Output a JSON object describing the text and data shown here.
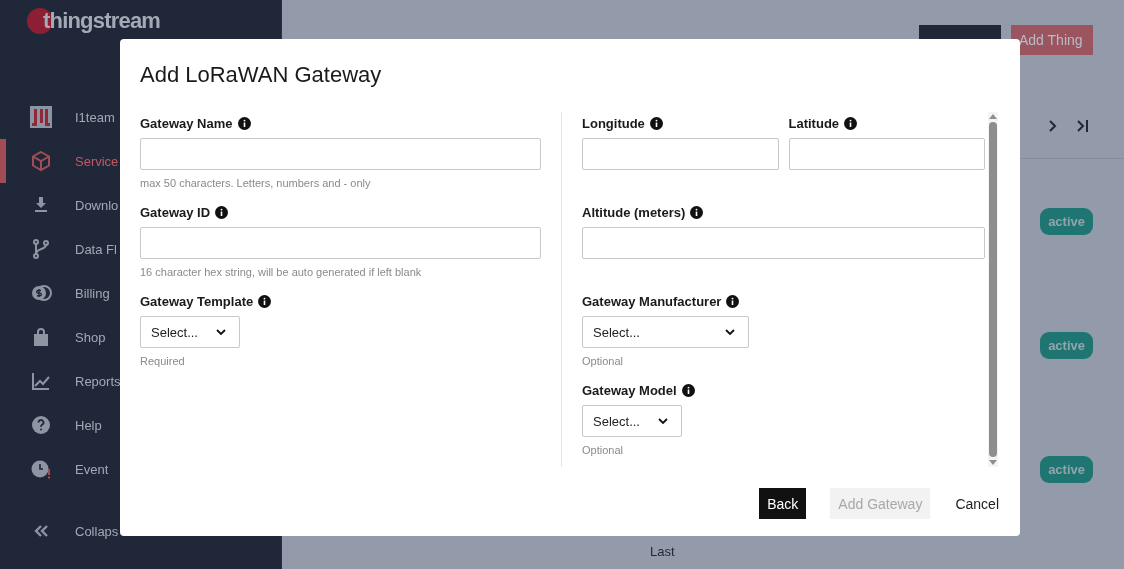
{
  "sidebar": {
    "logo": "thingstream",
    "team": {
      "label": "I1team"
    },
    "items": [
      {
        "label": "Service",
        "selected": true
      },
      {
        "label": "Downlo",
        "selected": false
      },
      {
        "label": "Data Fl",
        "selected": false
      },
      {
        "label": "Billing",
        "selected": false
      },
      {
        "label": "Shop",
        "selected": false
      },
      {
        "label": "Reports",
        "selected": false
      },
      {
        "label": "Help",
        "selected": false
      },
      {
        "label": "Event",
        "selected": false
      }
    ],
    "collapse": {
      "label": "Collaps"
    }
  },
  "page": {
    "actions": [
      {
        "kind": "menu"
      },
      {
        "label": "Add Thing",
        "kind": "primary"
      }
    ],
    "rows": [
      {
        "status": "active"
      },
      {
        "status": "active"
      },
      {
        "status": "active"
      }
    ],
    "footer_text": "Last"
  },
  "dialog": {
    "title": "Add LoRaWAN Gateway",
    "left": [
      [
        {
          "label": "Gateway Name",
          "kind": "text",
          "hint": "max 50 characters. Letters, numbers and - only"
        }
      ],
      [
        {
          "label": "Gateway ID",
          "kind": "text",
          "hint": "16 character hex string, will be auto generated if left blank"
        }
      ],
      [
        {
          "label": "Gateway Template",
          "kind": "select",
          "placeholder": "Select...",
          "wide": false,
          "hint": "Required"
        }
      ]
    ],
    "right": [
      [
        {
          "label": "Longitude",
          "kind": "text"
        },
        {
          "label": "Latitude",
          "kind": "text"
        }
      ],
      [
        {
          "label": "Altitude (meters)",
          "kind": "text"
        }
      ],
      [
        {
          "label": "Gateway Manufacturer",
          "kind": "select",
          "placeholder": "Select...",
          "wide": true,
          "hint": "Optional"
        }
      ],
      [
        {
          "label": "Gateway Model",
          "kind": "select",
          "placeholder": "Select...",
          "wide": false,
          "hint": "Optional"
        }
      ]
    ],
    "buttons": [
      {
        "label": "Back",
        "kind": "dark",
        "disabled": false
      },
      {
        "label": "Add Gateway",
        "kind": "dark",
        "disabled": true
      },
      {
        "label": "Cancel",
        "kind": "plain",
        "disabled": false
      }
    ]
  }
}
